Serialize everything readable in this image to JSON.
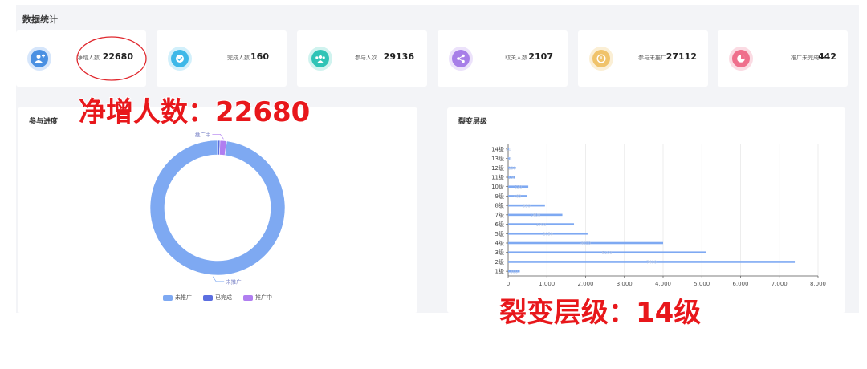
{
  "section_title": "数据统计",
  "stats": [
    {
      "label": "净增人数",
      "value": "22680",
      "icon": "user-add-icon",
      "color": "#4a90e2"
    },
    {
      "label": "完成人数",
      "value": "160",
      "icon": "check-circle-icon",
      "color": "#3db8e8"
    },
    {
      "label": "参与人次",
      "value": "29136",
      "icon": "group-icon",
      "color": "#2ec4b6"
    },
    {
      "label": "取关人数",
      "value": "2107",
      "icon": "share-icon",
      "color": "#a77ee8"
    },
    {
      "label": "参与未推广",
      "value": "27112",
      "icon": "pending-icon",
      "color": "#f0c36b"
    },
    {
      "label": "推广未完成",
      "value": "442",
      "icon": "pie-icon",
      "color": "#ef6f8c"
    }
  ],
  "annotations": {
    "net_increase": "净增人数：22680",
    "fission_levels": "裂变层级：14级"
  },
  "progress_chart": {
    "title": "参与进度",
    "legend": [
      "未推广",
      "已完成",
      "推广中"
    ],
    "colors": [
      "#7ea9f2",
      "#5b6ee0",
      "#b07ef0"
    ]
  },
  "levels_chart": {
    "title": "裂变层级"
  },
  "chart_data": [
    {
      "type": "pie",
      "title": "参与进度",
      "labels": [
        "未推广",
        "已完成",
        "推广中"
      ],
      "values": [
        27112,
        160,
        442
      ]
    },
    {
      "type": "bar",
      "orientation": "horizontal",
      "title": "裂变层级",
      "categories": [
        "1级",
        "2级",
        "3级",
        "4级",
        "5级",
        "6级",
        "7级",
        "8级",
        "9级",
        "10级",
        "11级",
        "12级",
        "13级",
        "14级"
      ],
      "values": [
        300,
        7400,
        5100,
        4000,
        2050,
        1700,
        1400,
        950,
        480,
        520,
        180,
        200,
        50,
        20
      ],
      "xticks": [
        "0",
        "1,000",
        "2,000",
        "3,000",
        "4,000",
        "5,000",
        "6,000",
        "7,000",
        "8,000"
      ],
      "xlim": [
        0,
        8000
      ],
      "grid": true
    }
  ]
}
